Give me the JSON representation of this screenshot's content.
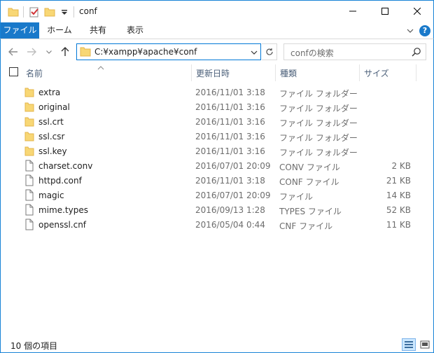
{
  "window": {
    "title": "conf"
  },
  "ribbon": {
    "tabs": [
      {
        "label": "ファイル"
      },
      {
        "label": "ホーム"
      },
      {
        "label": "共有"
      },
      {
        "label": "表示"
      }
    ],
    "help_label": "?"
  },
  "navigation": {
    "address": "C:¥xampp¥apache¥conf",
    "search_placeholder": "confの検索"
  },
  "columns": {
    "name": "名前",
    "date": "更新日時",
    "type": "種類",
    "size": "サイズ"
  },
  "files": [
    {
      "name": "extra",
      "date": "2016/11/01 3:18",
      "type": "ファイル フォルダー",
      "size": "",
      "icon": "folder-icon"
    },
    {
      "name": "original",
      "date": "2016/11/01 3:16",
      "type": "ファイル フォルダー",
      "size": "",
      "icon": "folder-icon"
    },
    {
      "name": "ssl.crt",
      "date": "2016/11/01 3:16",
      "type": "ファイル フォルダー",
      "size": "",
      "icon": "folder-icon"
    },
    {
      "name": "ssl.csr",
      "date": "2016/11/01 3:16",
      "type": "ファイル フォルダー",
      "size": "",
      "icon": "folder-icon"
    },
    {
      "name": "ssl.key",
      "date": "2016/11/01 3:16",
      "type": "ファイル フォルダー",
      "size": "",
      "icon": "folder-icon"
    },
    {
      "name": "charset.conv",
      "date": "2016/07/01 20:09",
      "type": "CONV ファイル",
      "size": "2 KB",
      "icon": "file-icon"
    },
    {
      "name": "httpd.conf",
      "date": "2016/11/01 3:18",
      "type": "CONF ファイル",
      "size": "21 KB",
      "icon": "file-icon"
    },
    {
      "name": "magic",
      "date": "2016/07/01 20:09",
      "type": "ファイル",
      "size": "14 KB",
      "icon": "file-icon"
    },
    {
      "name": "mime.types",
      "date": "2016/09/13 1:28",
      "type": "TYPES ファイル",
      "size": "52 KB",
      "icon": "file-icon"
    },
    {
      "name": "openssl.cnf",
      "date": "2016/05/04 0:44",
      "type": "CNF ファイル",
      "size": "11 KB",
      "icon": "file-icon"
    }
  ],
  "status": {
    "item_count": "10 個の項目"
  },
  "colors": {
    "accent": "#1979ca",
    "border": "#1883d7",
    "folder": "#f8d775",
    "folder_dark": "#e3b44b"
  }
}
